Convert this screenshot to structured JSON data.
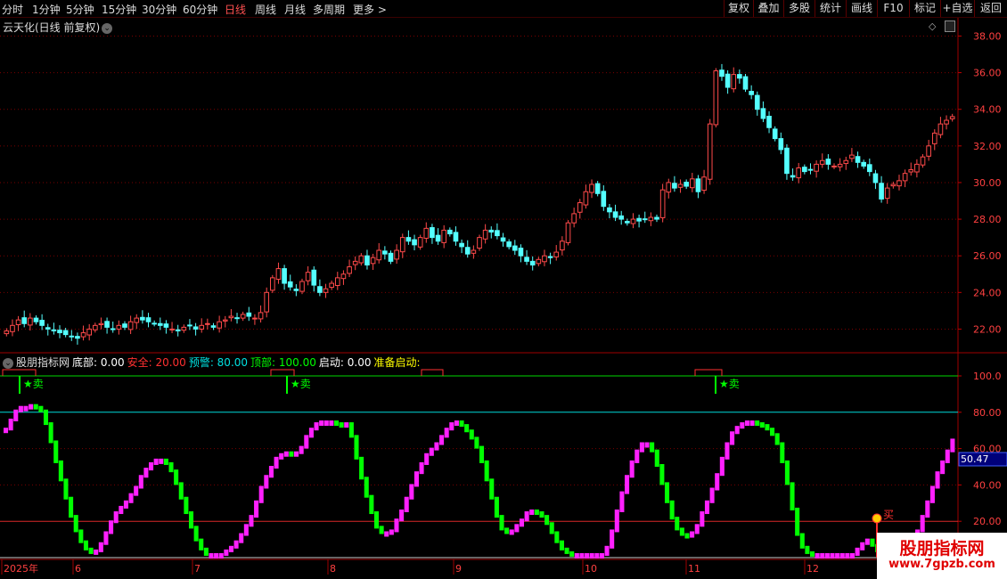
{
  "toolbar": {
    "tabs": [
      "分时",
      "1分钟",
      "5分钟",
      "15分钟",
      "30分钟",
      "60分钟",
      "日线",
      "周线",
      "月线",
      "多周期",
      "更多 >"
    ],
    "active_tab": "日线",
    "right_buttons": [
      "复权",
      "叠加",
      "多股",
      "统计",
      "画线",
      "F10",
      "标记",
      "+自选",
      "返回"
    ]
  },
  "main_chart": {
    "title": "云天化(日线 前复权)",
    "price_ticks": [
      "38.00",
      "36.00",
      "34.00",
      "32.00",
      "30.00",
      "28.00",
      "26.00",
      "24.00",
      "22.00"
    ]
  },
  "indicator": {
    "name": "股朋指标网",
    "params": [
      {
        "label": "底部: 0.00",
        "color": "#ffffff"
      },
      {
        "label": "安全: 20.00",
        "color": "#ff3030"
      },
      {
        "label": "预警: 80.00",
        "color": "#00e0e0"
      },
      {
        "label": "顶部: 100.00",
        "color": "#00ff00"
      },
      {
        "label": "启动: 0.00",
        "color": "#ffffff"
      },
      {
        "label": "准备启动:",
        "color": "#ffff00"
      }
    ],
    "ticks": [
      "100.0",
      "80.00",
      "60.00",
      "40.00",
      "20.00"
    ],
    "current_value": "50.47",
    "sell_label": "★卖",
    "buy_label": "买"
  },
  "date_axis": {
    "labels": [
      "2025年",
      "6",
      "7",
      "8",
      "9",
      "10",
      "11",
      "12"
    ]
  },
  "watermark": {
    "line1": "股朋指标网",
    "line2": "www.7gpzb.com"
  },
  "colors": {
    "up": "#ff4a4a",
    "down": "#54ffff",
    "osc_up": "#ff20ff",
    "osc_down": "#00ff00",
    "grid": "#7a0000"
  },
  "chart_data": [
    {
      "type": "candlestick",
      "title": "云天化(日线 前复权)",
      "ylim": [
        21.0,
        38.8
      ],
      "close": [
        21.9,
        22.2,
        22.5,
        22.3,
        22.6,
        22.4,
        22.2,
        22.0,
        21.9,
        21.8,
        21.7,
        21.6,
        21.5,
        21.8,
        22.0,
        22.2,
        22.3,
        22.1,
        22.0,
        22.2,
        22.1,
        22.4,
        22.6,
        22.5,
        22.4,
        22.3,
        22.2,
        22.1,
        22.0,
        21.9,
        22.1,
        22.2,
        22.0,
        22.2,
        22.3,
        22.1,
        22.4,
        22.5,
        22.7,
        22.6,
        22.8,
        22.7,
        22.6,
        22.9,
        24.0,
        24.8,
        25.3,
        24.5,
        24.3,
        24.1,
        24.6,
        25.1,
        24.4,
        24.0,
        24.2,
        24.5,
        24.8,
        25.0,
        25.4,
        25.7,
        26.0,
        25.5,
        25.9,
        26.3,
        26.1,
        25.7,
        26.3,
        27.0,
        26.8,
        26.6,
        27.0,
        27.5,
        27.0,
        26.8,
        27.4,
        27.2,
        26.8,
        26.5,
        26.1,
        26.3,
        27.0,
        27.4,
        27.3,
        27.1,
        26.8,
        26.5,
        26.3,
        26.0,
        25.7,
        25.5,
        25.8,
        26.0,
        25.9,
        26.2,
        26.8,
        27.8,
        28.3,
        28.9,
        29.5,
        29.9,
        29.4,
        28.7,
        28.4,
        28.1,
        28.0,
        27.8,
        28.0,
        27.9,
        28.0,
        28.1,
        28.0,
        29.6,
        30.0,
        29.7,
        29.9,
        29.8,
        30.2,
        29.5,
        30.3,
        33.2,
        36.1,
        35.8,
        35.2,
        35.9,
        35.7,
        35.1,
        34.8,
        34.0,
        33.5,
        33.0,
        32.4,
        31.8,
        30.5,
        30.3,
        30.8,
        30.6,
        30.7,
        31.0,
        31.2,
        31.0,
        30.9,
        31.0,
        31.2,
        31.5,
        31.1,
        30.9,
        30.6,
        30.0,
        29.1,
        29.7,
        29.9,
        30.1,
        30.5,
        30.7,
        31.0,
        31.4,
        32.0,
        32.7,
        33.2,
        33.4,
        33.6
      ]
    },
    {
      "type": "bar",
      "title": "股朋指标网",
      "ylim": [
        0,
        100
      ],
      "reference_lines": [
        0,
        20,
        80,
        100
      ],
      "values": [
        70,
        75,
        80,
        82,
        82,
        83,
        82,
        80,
        73,
        63,
        52,
        42,
        32,
        22,
        14,
        8,
        4,
        2,
        3,
        7,
        13,
        19,
        24,
        27,
        30,
        34,
        38,
        44,
        48,
        51,
        53,
        53,
        51,
        47,
        40,
        32,
        24,
        16,
        9,
        4,
        1,
        1,
        1,
        1,
        3,
        5,
        8,
        12,
        17,
        22,
        30,
        38,
        44,
        49,
        54,
        56,
        57,
        56,
        57,
        60,
        66,
        70,
        73,
        74,
        74,
        74,
        73,
        72,
        73,
        66,
        54,
        43,
        33,
        24,
        16,
        13,
        13,
        14,
        20,
        25,
        32,
        39,
        46,
        51,
        56,
        59,
        62,
        66,
        70,
        73,
        74,
        72,
        69,
        65,
        60,
        52,
        42,
        32,
        22,
        15,
        13,
        14,
        17,
        20,
        24,
        25,
        24,
        22,
        18,
        13,
        8,
        4,
        2,
        1,
        1,
        1,
        1,
        1,
        1,
        1,
        5,
        14,
        25,
        35,
        44,
        52,
        58,
        62,
        62,
        58,
        50,
        40,
        30,
        21,
        15,
        12,
        11,
        13,
        17,
        24,
        30,
        37,
        45,
        54,
        62,
        68,
        71,
        73,
        74,
        74,
        73,
        72,
        70,
        67,
        62,
        52,
        40,
        26,
        12,
        5,
        2,
        1,
        1,
        1,
        1,
        1,
        1,
        1,
        1,
        1,
        4,
        7,
        9,
        6,
        3,
        1,
        1,
        1,
        1,
        1,
        3,
        8,
        14,
        22,
        30,
        38,
        46,
        52,
        58,
        64
      ]
    }
  ]
}
